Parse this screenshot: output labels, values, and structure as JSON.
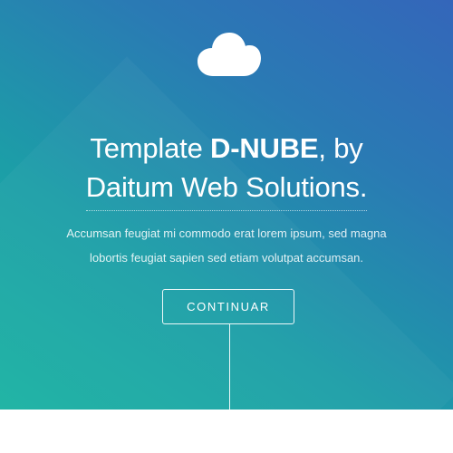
{
  "hero": {
    "icon": "cloud-icon",
    "title_prefix": "Template ",
    "title_brand": "D-NUBE",
    "title_suffix": ", by",
    "title_line2": "Daitum Web Solutions.",
    "subtitle_line1": "Accumsan feugiat mi commodo erat lorem ipsum, sed magna",
    "subtitle_line2": "lobortis feugiat sapien sed etiam volutpat accumsan.",
    "button_label": "CONTINUAR"
  },
  "colors": {
    "gradient_start": "#1ab3a2",
    "gradient_mid": "#1c9ea7",
    "gradient_end": "#3466ba",
    "text": "#ffffff",
    "page_bottom": "#ffffff"
  }
}
